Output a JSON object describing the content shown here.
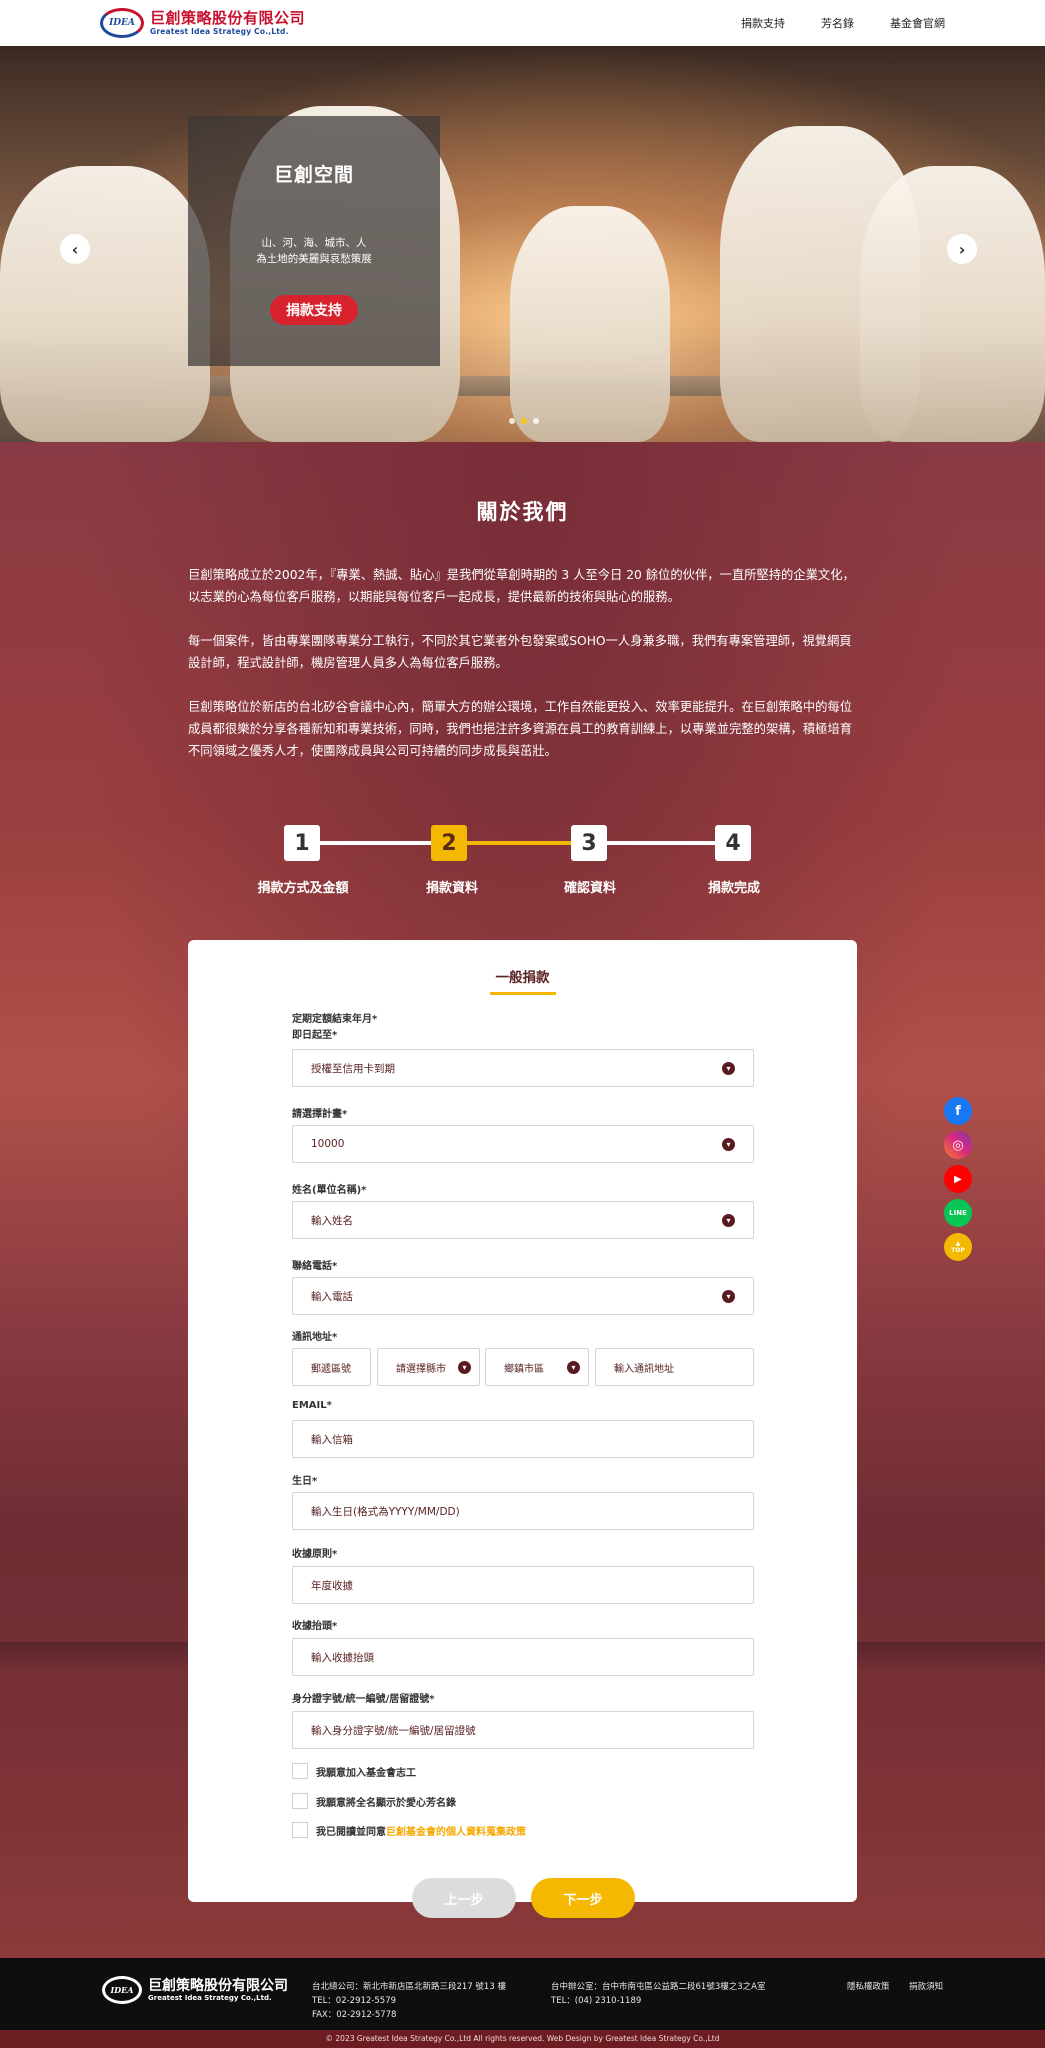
{
  "header": {
    "logo_badge": "IDEA",
    "logo_cn": "巨創策略股份有限公司",
    "logo_en": "Greatest Idea Strategy Co.,Ltd.",
    "nav": [
      "捐款支持",
      "芳名錄",
      "基金會官網"
    ]
  },
  "hero": {
    "title": "巨創空間",
    "sub_line1": "山、河、海、城市、人",
    "sub_line2": "為土地的美麗與哀愁策展",
    "button": "捐款支持",
    "prev": "‹",
    "next": "›",
    "slide_count": 3,
    "active_slide": 2
  },
  "about": {
    "title": "關於我們",
    "p1": "巨創策略成立於2002年，『專業、熱誠、貼心』是我們從草創時期的 3 人至今日 20 餘位的伙伴，一直所堅持的企業文化，以志業的心為每位客戶服務，以期能與每位客戶一起成長，提供最新的技術與貼心的服務。",
    "p2": "每一個案件，皆由專業團隊專業分工執行，不同於其它業者外包發案或SOHO一人身兼多職，我們有專案管理師，視覺網頁設計師，程式設計師，機房管理人員多人為每位客戶服務。",
    "p3": "巨創策略位於新店的台北矽谷會議中心內，簡單大方的辦公環境，工作自然能更投入、效率更能提升。在巨創策略中的每位成員都很樂於分享各種新知和專業技術，同時，我們也挹注許多資源在員工的教育訓練上，以專業並完整的架構，積極培育不同領域之優秀人才，使團隊成員與公司可持續的同步成長與茁壯。"
  },
  "steps": [
    {
      "num": "1",
      "label": "捐款方式及金額"
    },
    {
      "num": "2",
      "label": "捐款資料"
    },
    {
      "num": "3",
      "label": "確認資料"
    },
    {
      "num": "4",
      "label": "捐款完成"
    }
  ],
  "current_step": 2,
  "form": {
    "title": "一般捐款",
    "period_label1": "定期定額結束年月*",
    "period_label2": "即日起至*",
    "period_value": "授權至信用卡到期",
    "plan_label": "請選擇計畫*",
    "plan_value": "10000",
    "name_label": "姓名(單位名稱)*",
    "name_placeholder": "輸入姓名",
    "phone_label": "聯絡電話*",
    "phone_placeholder": "輸入電話",
    "address_label": "通訊地址*",
    "zip_placeholder": "郵遞區號",
    "county_value": "請選擇縣市",
    "district_value": "鄉鎮市區",
    "address_placeholder": "輸入通訊地址",
    "email_label": "EMAIL*",
    "email_placeholder": "輸入信箱",
    "birthday_label": "生日*",
    "birthday_placeholder": "輸入生日(格式為YYYY/MM/DD)",
    "receipt_rule_label": "收據原則*",
    "receipt_rule_value": "年度收據",
    "receipt_title_label": "收據抬頭*",
    "receipt_title_placeholder": "輸入收據抬頭",
    "id_label": "身分證字號/統一編號/居留證號*",
    "id_placeholder": "輸入身分證字號/統一編號/居留證號",
    "check1": "我願意加入基金會志工",
    "check2": "我願意將全名顯示於愛心芳名錄",
    "check3_prefix": "我已閱讀並同意",
    "check3_link": "巨創基金會的個人資料蒐集政策",
    "prev_button": "上一步",
    "next_button": "下一步"
  },
  "social": {
    "facebook": "f",
    "instagram": "◎",
    "youtube": "▶",
    "line": "LINE",
    "top_arrow": "▲",
    "top_label": "TOP"
  },
  "footer": {
    "logo_badge": "IDEA",
    "logo_cn": "巨創策略股份有限公司",
    "logo_en": "Greatest Idea Strategy Co.,Ltd.",
    "taipei_addr": "台北總公司：新北市新店區北新路三段217 號13 樓",
    "taipei_tel": "TEL：02-2912-5579",
    "taipei_fax": "FAX：02-2912-5778",
    "taichung_addr": "台中辦公室：台中市南屯區公益路二段61號3樓之3之A室",
    "taichung_tel": "TEL：(04) 2310-1189",
    "privacy": "隱私權政策",
    "notice": "捐款須知",
    "copyright": "© 2023 Greatest Idea Strategy Co.,Ltd All rights reserved. Web Design by Greatest Idea Strategy Co.,Ltd"
  }
}
